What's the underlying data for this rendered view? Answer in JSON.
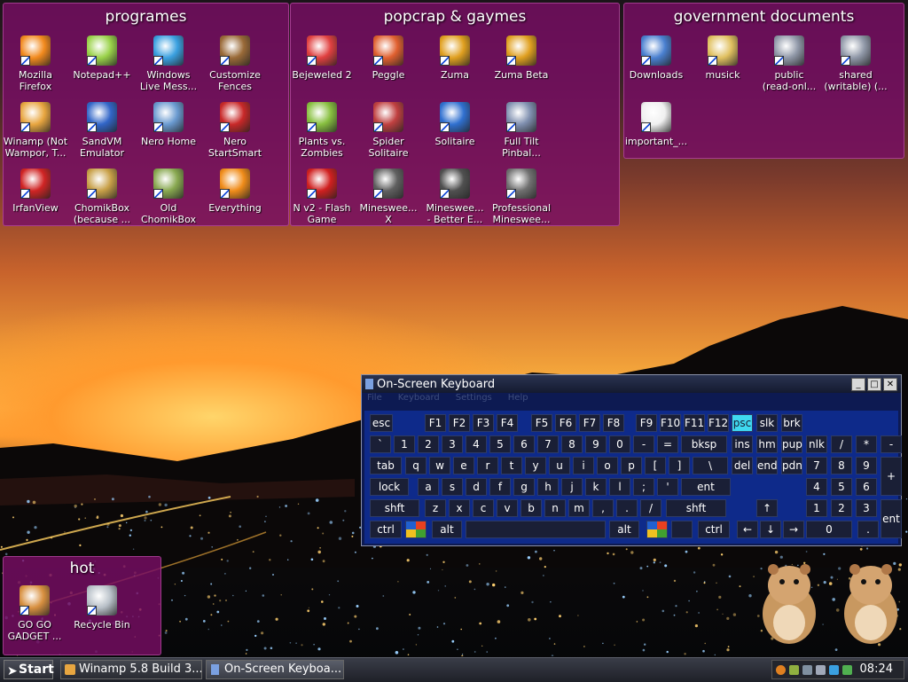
{
  "fences": {
    "programs": {
      "title": "programes",
      "icons": [
        {
          "label": "Mozilla\nFirefox",
          "color": "#f28a1e"
        },
        {
          "label": "Notepad++",
          "color": "#9ad24a"
        },
        {
          "label": "Windows\nLive Mess...",
          "color": "#3aa0e0"
        },
        {
          "label": "Customize\nFences",
          "color": "#9a6a38"
        },
        {
          "label": "Winamp (Not\nWampor, T...",
          "color": "#e8a640"
        },
        {
          "label": "SandVM\nEmulator",
          "color": "#3266c8"
        },
        {
          "label": "Nero Home",
          "color": "#6a9ad0"
        },
        {
          "label": "Nero\nStartSmart",
          "color": "#c82828"
        },
        {
          "label": "IrfanView",
          "color": "#d02424"
        },
        {
          "label": "ChomikBox\n(because ...",
          "color": "#c8a048"
        },
        {
          "label": "Old\nChomikBox",
          "color": "#88a850"
        },
        {
          "label": "Everything",
          "color": "#f08c1a"
        }
      ]
    },
    "games": {
      "title": "popcrap & gaymes",
      "icons": [
        {
          "label": "Bejeweled 2",
          "color": "#e04040"
        },
        {
          "label": "Peggle",
          "color": "#e06030"
        },
        {
          "label": "Zuma",
          "color": "#e0a020"
        },
        {
          "label": "Zuma Beta",
          "color": "#e0a020"
        },
        {
          "label": "Plants vs.\nZombies",
          "color": "#88c040"
        },
        {
          "label": "Spider\nSolitaire",
          "color": "#c04040"
        },
        {
          "label": "Solitaire",
          "color": "#3070d0"
        },
        {
          "label": "Full Tilt\nPinbal...",
          "color": "#8090b0"
        },
        {
          "label": "N v2 - Flash\nGame",
          "color": "#d02020"
        },
        {
          "label": "Mineswee...\nX",
          "color": "#606060"
        },
        {
          "label": "Mineswee...\n- Better E...",
          "color": "#505050"
        },
        {
          "label": "Professional\nMineswee...",
          "color": "#707070"
        }
      ]
    },
    "government": {
      "title": "government documents",
      "icons": [
        {
          "label": "Downloads",
          "color": "#4a80d0"
        },
        {
          "label": "musick",
          "color": "#e0c060"
        },
        {
          "label": "public\n(read-onl...",
          "color": "#9098a8"
        },
        {
          "label": "shared\n(writable) (...",
          "color": "#9098a8"
        },
        {
          "label": "important_...",
          "color": "#f0f0f0"
        }
      ]
    },
    "hot": {
      "title": "hot",
      "icons": [
        {
          "label": "GO GO\nGADGET ...",
          "color": "#d89040"
        },
        {
          "label": "Recycle Bin",
          "color": "#b8c0c8"
        }
      ]
    }
  },
  "osk": {
    "title": "On-Screen Keyboard",
    "menu": [
      "File",
      "Keyboard",
      "Settings",
      "Help"
    ],
    "rows": [
      [
        "esc",
        "F1",
        "F2",
        "F3",
        "F4",
        "F5",
        "F6",
        "F7",
        "F8",
        "F9",
        "F10",
        "F11",
        "F12",
        "psc",
        "slk",
        "brk"
      ],
      [
        "`",
        "1",
        "2",
        "3",
        "4",
        "5",
        "6",
        "7",
        "8",
        "9",
        "0",
        "-",
        "=",
        "bksp",
        "ins",
        "hm",
        "pup",
        "nlk",
        "/",
        "*",
        "-"
      ],
      [
        "tab",
        "q",
        "w",
        "e",
        "r",
        "t",
        "y",
        "u",
        "i",
        "o",
        "p",
        "[",
        "]",
        "\\",
        "del",
        "end",
        "pdn",
        "7",
        "8",
        "9",
        "+"
      ],
      [
        "lock",
        "a",
        "s",
        "d",
        "f",
        "g",
        "h",
        "j",
        "k",
        "l",
        ";",
        "'",
        "ent",
        "4",
        "5",
        "6"
      ],
      [
        "shft",
        "z",
        "x",
        "c",
        "v",
        "b",
        "n",
        "m",
        ",",
        ".",
        "/",
        "shft",
        "↑",
        "1",
        "2",
        "3",
        "ent"
      ],
      [
        "ctrl",
        "alt",
        "alt",
        "ctrl",
        "←",
        "↓",
        "→",
        "0",
        "."
      ]
    ]
  },
  "taskbar": {
    "start": "Start",
    "tasks": [
      "Winamp 5.8 Build 3...",
      "On-Screen Keyboa..."
    ],
    "clock": "08:24"
  }
}
